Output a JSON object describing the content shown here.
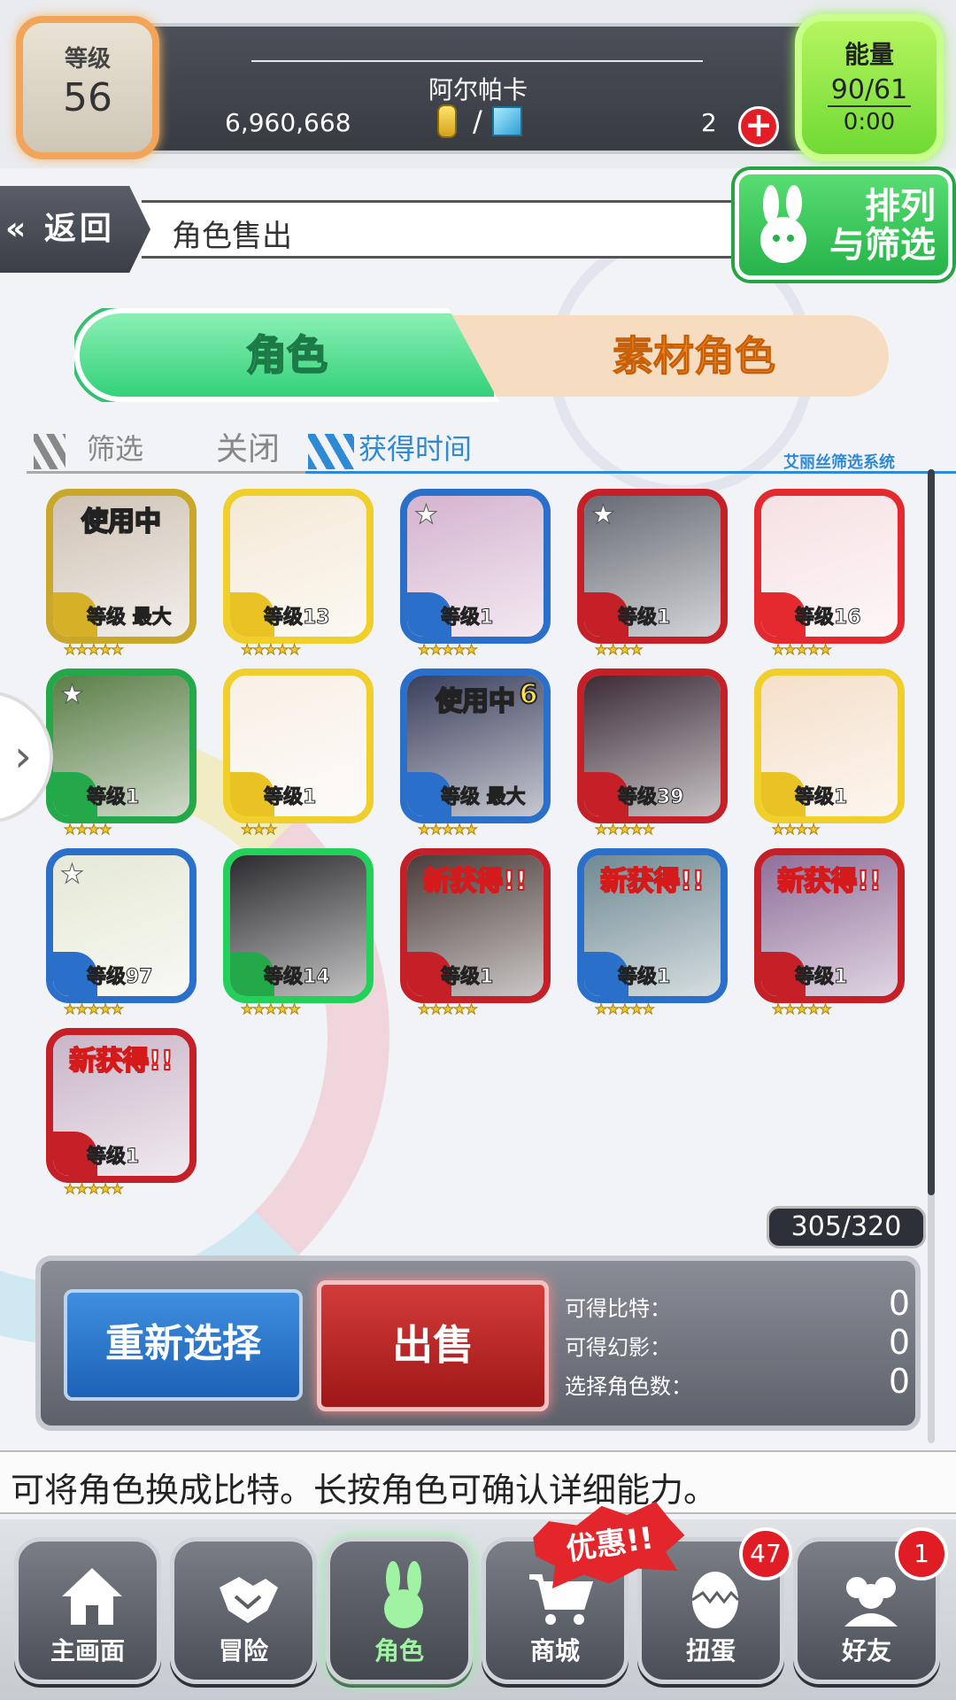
{
  "colors": {
    "accent_green": "#33d17a",
    "accent_orange": "#f2851f",
    "sell_red": "#b41c1c",
    "reselect_blue": "#1d62b7",
    "filter_blue": "#2f8ad6"
  },
  "header": {
    "level_label": "等级",
    "level_value": "56",
    "player_name": "阿尔帕卡",
    "currency": "6,960,668",
    "gem_count": "2",
    "add_icon": "plus-icon",
    "energy_label": "能量",
    "energy_value": "90/61",
    "energy_time": "0:00"
  },
  "nav": {
    "back_label": "返回",
    "page_title": "角色售出",
    "sort_label_1": "排列",
    "sort_label_2": "与筛选"
  },
  "tabs": {
    "character": "角色",
    "material": "素材角色"
  },
  "filter": {
    "filter_label": "筛选",
    "filter_state": "关闭",
    "sort_order": "获得时间",
    "system_name": "艾丽丝筛选系统"
  },
  "cards": [
    {
      "tag": "使用中",
      "level": "等级 最大",
      "stars": "★★★★★",
      "frame": "#c8a72a",
      "element": "#d6b026",
      "art": "#cfc3b5",
      "star_badge": ""
    },
    {
      "tag": "",
      "level": "等级13",
      "stars": "★★★★★",
      "frame": "#f0cf2a",
      "element": "#e9c224",
      "art": "#f4e9d6",
      "star_badge": ""
    },
    {
      "tag": "",
      "level": "等级1",
      "stars": "★★★★★",
      "frame": "#2a6fc9",
      "element": "#2a6fc9",
      "art": "#d4b3ce",
      "star_badge": "★"
    },
    {
      "tag": "",
      "level": "等级1",
      "stars": "★★★★",
      "frame": "#c52027",
      "element": "#c52027",
      "art": "#676a74",
      "star_badge": "★"
    },
    {
      "tag": "",
      "level": "等级16",
      "stars": "★★★★★",
      "frame": "#e42a2f",
      "element": "#e42a2f",
      "art": "#f6e1e4",
      "star_badge": ""
    },
    {
      "tag": "",
      "level": "等级1",
      "stars": "★★★★",
      "frame": "#23a84a",
      "element": "#23a84a",
      "art": "#5b7f47",
      "star_badge": "★"
    },
    {
      "tag": "",
      "level": "等级1",
      "stars": "★★★",
      "frame": "#f0cf2a",
      "element": "#e9c224",
      "art": "#f8f0e6",
      "star_badge": ""
    },
    {
      "tag": "使用中",
      "level": "等级 最大",
      "stars": "★★★★★",
      "frame": "#2a6fc9",
      "element": "#2a6fc9",
      "art": "#3a3f5c",
      "star_badge": "",
      "extra": "6"
    },
    {
      "tag": "",
      "level": "等级39",
      "stars": "★★★★★",
      "frame": "#c52027",
      "element": "#c52027",
      "art": "#3b2b36",
      "star_badge": ""
    },
    {
      "tag": "",
      "level": "等级1",
      "stars": "★★★★",
      "frame": "#f0cf2a",
      "element": "#e9c224",
      "art": "#f5dfc9",
      "star_badge": ""
    },
    {
      "tag": "",
      "level": "等级97",
      "stars": "★★★★★",
      "frame": "#2a6fc9",
      "element": "#2a6fc9",
      "art": "#e5e9d6",
      "star_badge": "★"
    },
    {
      "tag": "",
      "level": "等级14",
      "stars": "★★★★★",
      "frame": "#23d15a",
      "element": "#23a84a",
      "art": "#2b2a2e",
      "star_badge": ""
    },
    {
      "tag": "新获得!!",
      "level": "等级1",
      "stars": "★★★★★",
      "frame": "#c52027",
      "element": "#c52027",
      "art": "#4a3c3a",
      "star_badge": ""
    },
    {
      "tag": "新获得!!",
      "level": "等级1",
      "stars": "★★★★★",
      "frame": "#2a6fc9",
      "element": "#2a6fc9",
      "art": "#6f8a93",
      "star_badge": ""
    },
    {
      "tag": "新获得!!",
      "level": "等级1",
      "stars": "★★★★★",
      "frame": "#c52027",
      "element": "#c52027",
      "art": "#8f6f9a",
      "star_badge": ""
    },
    {
      "tag": "新获得!!",
      "level": "等级1",
      "stars": "★★★★★",
      "frame": "#c52027",
      "element": "#c52027",
      "art": "#c9b5c8",
      "star_badge": ""
    }
  ],
  "inventory_count": "305/320",
  "sell_panel": {
    "reselect_label": "重新选择",
    "sell_label": "出售",
    "rows": [
      {
        "label": "可得比特：",
        "value": "0"
      },
      {
        "label": "可得幻影：",
        "value": "0"
      },
      {
        "label": "选择角色数：",
        "value": "0"
      }
    ]
  },
  "hint": "可将角色换成比特。长按角色可确认详细能力。",
  "promo": "优惠!!",
  "bottom_nav": [
    {
      "label": "主画面",
      "icon": "home-icon",
      "badge": ""
    },
    {
      "label": "冒险",
      "icon": "handshake-icon",
      "badge": ""
    },
    {
      "label": "角色",
      "icon": "bunny-icon",
      "badge": ""
    },
    {
      "label": "商城",
      "icon": "cart-icon",
      "badge": ""
    },
    {
      "label": "扭蛋",
      "icon": "egg-icon",
      "badge": "47"
    },
    {
      "label": "好友",
      "icon": "friends-icon",
      "badge": "1"
    }
  ]
}
